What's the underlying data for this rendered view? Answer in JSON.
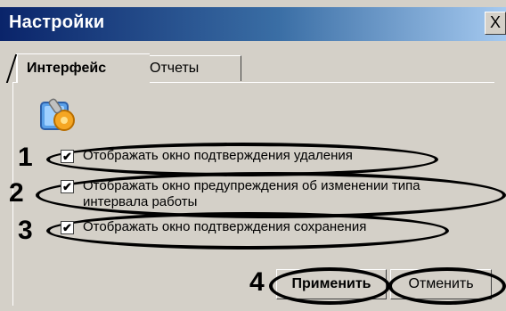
{
  "window": {
    "title": "Настройки",
    "close_glyph": "X"
  },
  "tabs": [
    {
      "label": "Интерфейс"
    },
    {
      "label": "Отчеты"
    }
  ],
  "icon": {
    "name": "settings-icon"
  },
  "options": [
    {
      "marker": "1",
      "label": "Отображать окно подтверждения удаления",
      "checked": true
    },
    {
      "marker": "2",
      "label_line1": "Отображать окно предупреждения об изменении типа",
      "label_line2": "интервала работы",
      "checked": true
    },
    {
      "marker": "3",
      "label": "Отображать окно подтверждения сохранения",
      "checked": true
    }
  ],
  "buttons": {
    "marker": "4",
    "apply_label": "Применить",
    "cancel_label": "Отменить"
  },
  "colors": {
    "titlebar_start": "#0a246a",
    "titlebar_end": "#a6caf0",
    "face": "#d4d0c8"
  }
}
